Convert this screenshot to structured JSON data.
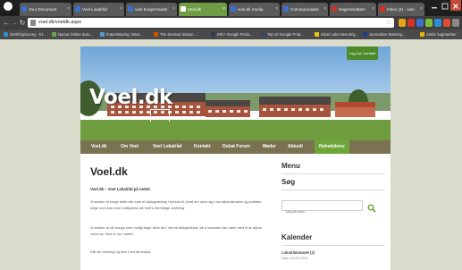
{
  "browser": {
    "tabs": [
      {
        "label": "Your Document"
      },
      {
        "label": "Voel Lokalråd"
      },
      {
        "label": "voel borgerrmøde"
      },
      {
        "label": "Voel.dk"
      },
      {
        "label": "voel.dk media"
      },
      {
        "label": "Communication"
      },
      {
        "label": "Søgeresultater"
      },
      {
        "label": "Inbox (2) - voel"
      }
    ],
    "url": "voel.dk/voeldk.aspx",
    "bookmarks": [
      {
        "label": "DeskTopSurvey - El..."
      },
      {
        "label": "Namut Online Surv..."
      },
      {
        "label": "FutureMacing: letter..."
      },
      {
        "label": "The Survival Station ..."
      },
      {
        "label": "ERI • Google Tecko..."
      },
      {
        "label": "Top 10 Google Prod..."
      },
      {
        "label": "Silver Lake New Brg..."
      },
      {
        "label": "Journalism Warning..."
      },
      {
        "label": "Andre bogmærker"
      }
    ]
  },
  "site": {
    "logo": "Voel.dk",
    "login_button": "Log ind / kontakt",
    "menu": [
      {
        "label": "Voel.dk"
      },
      {
        "label": "Om Voel"
      },
      {
        "label": "Voel Lokalråd"
      },
      {
        "label": "Kontakt"
      },
      {
        "label": "Debat Forum"
      },
      {
        "label": "Møder"
      },
      {
        "label": "Aktuelt"
      },
      {
        "label": "Nyhedsbrev"
      }
    ],
    "content": {
      "title": "Voel.dk",
      "subtitle": "Voel.dk – Voel Lokalråd på nettet.",
      "paragraphs": [
        "Vi ønsker at bruge dette site som et dialogværktøj i forhold til, hvad der rører sig i det administrative og politiske miljø, som kan have indflydelse på Voel's fremtidige udvikling.",
        "Vi ønsker at så mange som muligt tager aktiv del i denne dialog/debat, så vi sammen kan være med til at styrke vores by. Vind er lov i nettet.",
        "Klik din omkring og kom med dit indspil."
      ]
    },
    "sidebar": {
      "menu_heading": "Menu",
      "search_heading": "Søg",
      "search_placeholder": "Søg på siden ...",
      "calendar_heading": "Kalender",
      "calendar_item": "Lokalrådsmøde (2)",
      "calendar_date": "Dato: 22.05.2013"
    }
  },
  "colors": {
    "menu_bar": "#7a7250",
    "accent_green": "#6fa63a",
    "page_bg": "#d9dccb"
  }
}
